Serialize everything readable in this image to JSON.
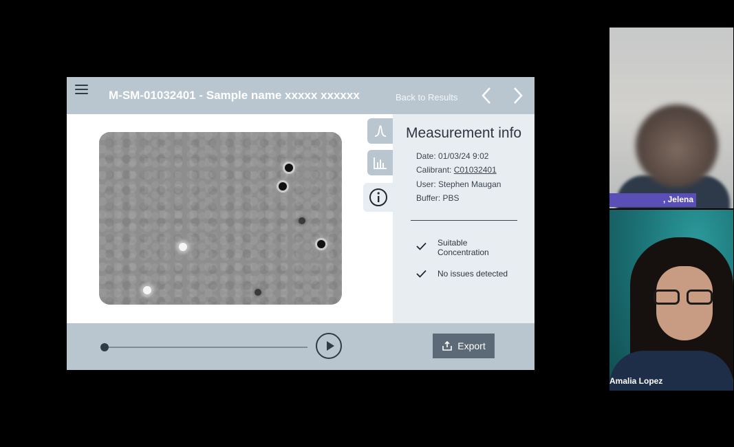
{
  "app": {
    "title": "M-SM-01032401 - Sample name xxxxx xxxxxx",
    "back_label": "Back to Results",
    "info": {
      "heading": "Measurement info",
      "date": "Date: 01/03/24  9:02",
      "calibrant_label": "Calibrant: ",
      "calibrant_value": "C01032401",
      "user": "User: Stephen Maugan",
      "buffer": "Buffer: PBS",
      "checks": [
        "Suitable Concentration",
        "No issues detected"
      ]
    },
    "playback_position": 0,
    "export_label": "Export",
    "colors": {
      "header": "#b9c6d0",
      "panel": "#e8edf1",
      "button": "#5b6a76"
    }
  },
  "participants": [
    {
      "name": ", Jelena",
      "video": "blurred"
    },
    {
      "name": "Amalia Lopez",
      "video": "on"
    }
  ]
}
